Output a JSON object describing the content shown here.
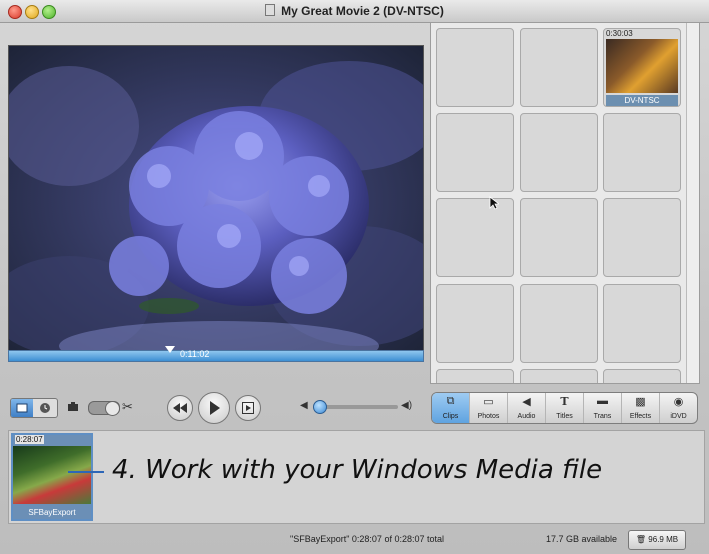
{
  "window": {
    "title": "My Great Movie 2 (DV-NTSC)"
  },
  "viewer": {
    "playhead_time": "0:11:02",
    "playhead_fraction": 0.4
  },
  "shelf": {
    "clip": {
      "duration": "0:30:03",
      "name": "DV-NTSC"
    }
  },
  "tools": [
    {
      "label": "Clips",
      "icon": "clips-icon"
    },
    {
      "label": "Photos",
      "icon": "photos-icon"
    },
    {
      "label": "Audio",
      "icon": "audio-icon"
    },
    {
      "label": "Titles",
      "icon": "titles-icon"
    },
    {
      "label": "Trans",
      "icon": "transitions-icon"
    },
    {
      "label": "Effects",
      "icon": "effects-icon"
    },
    {
      "label": "iDVD",
      "icon": "idvd-icon"
    }
  ],
  "timeline": {
    "clip": {
      "duration": "0:28:07",
      "name": "SFBayExport"
    },
    "caption": "4. Work with your Windows Media file"
  },
  "status": {
    "info": "\"SFBayExport\"  0:28:07 of 0:28:07 total",
    "available": "17.7 GB available",
    "trash": "96.9 MB"
  },
  "volume": {
    "level": 0.0
  },
  "colors": {
    "accent": "#3d8fd3",
    "timeline_clip": "#6b8fb6",
    "arrow": "#2d66b7"
  }
}
